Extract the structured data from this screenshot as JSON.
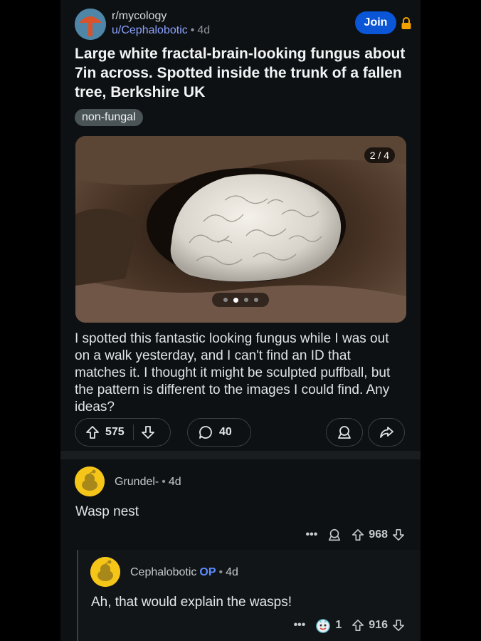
{
  "post": {
    "subreddit": "r/mycology",
    "author": "u/Cephalobotic",
    "separator": "•",
    "time": "4d",
    "join_label": "Join",
    "title": "Large white fractal-brain-looking fungus about 7in across. Spotted inside the trunk of a fallen tree, Berkshire UK",
    "flair": "non-fungal",
    "media_counter": "2 / 4",
    "media_page": 2,
    "media_total": 4,
    "body": "I spotted this fantastic looking fungus while I was out on a walk yesterday, and I can't find an ID that matches it. I thought it might be sculpted puffball, but the pattern is different to the images I could find. Any ideas?",
    "votes": "575",
    "comments": "40"
  },
  "comments": [
    {
      "author": "Grundel-",
      "separator": "•",
      "time": "4d",
      "text": "Wasp nest",
      "more": "•••",
      "votes": "968"
    },
    {
      "author": "Cephalobotic",
      "op_badge": "OP",
      "separator": "•",
      "time": "4d",
      "text": "Ah, that would explain the wasps!",
      "more": "•••",
      "award_count": "1",
      "votes": "916"
    }
  ],
  "colors": {
    "join": "#0a56d6",
    "user_link": "#8ba2ff",
    "op_badge": "#5c8cff",
    "lock": "#f2a100",
    "avatar": "#f5c518"
  }
}
